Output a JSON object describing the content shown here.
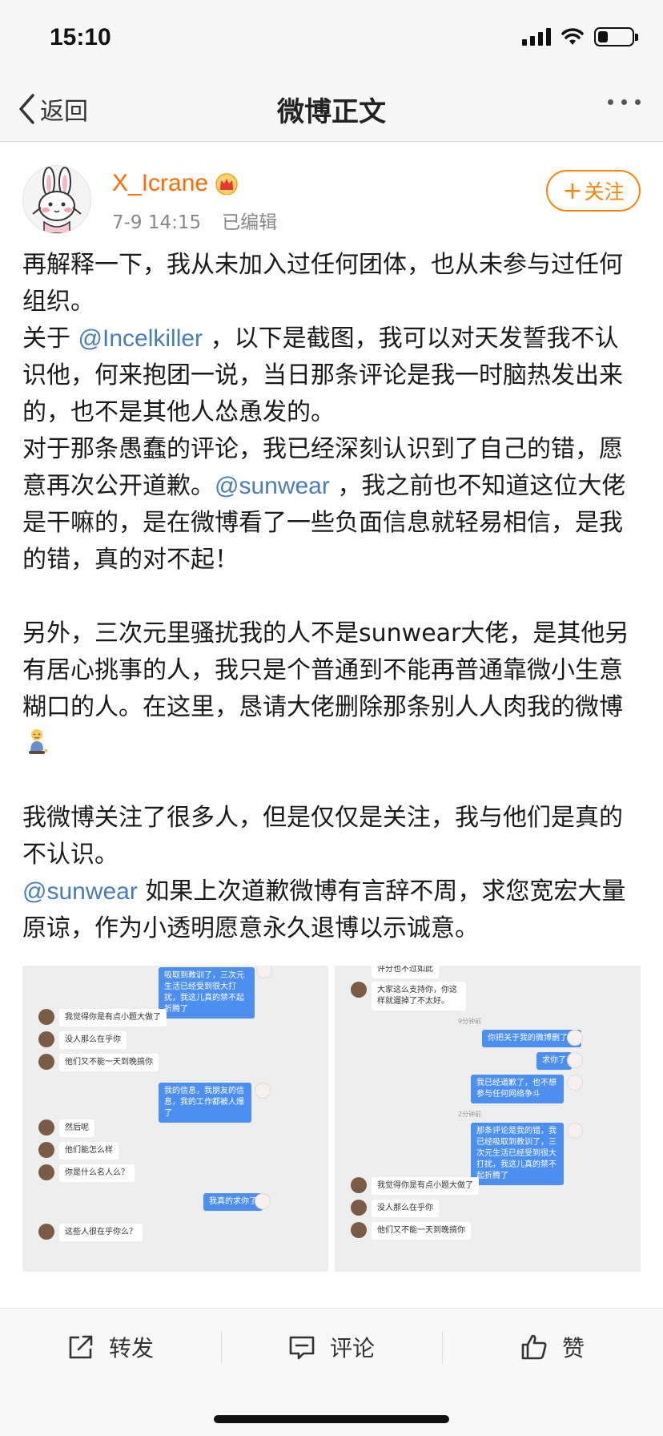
{
  "status_bar": {
    "time": "15:10",
    "battery_level": 0.3
  },
  "nav": {
    "back_label": "返回",
    "title": "微博正文"
  },
  "author": {
    "username": "X_Icrane",
    "date": "7-9 14:15",
    "edited": "已编辑",
    "follow_label": "关注",
    "name_color": "#ff6a00",
    "badge_icon": "crown-badge-icon"
  },
  "post": {
    "p1": "再解释一下，我从未加入过任何团体，也从未参与过任何组织。",
    "p2_pre": "关于 ",
    "mention1": "@Incelkiller",
    "p2_post": " ，以下是截图，我可以对天发誓我不认识他，何来抱团一说，当日那条评论是我一时脑热发出来的，也不是其他人怂恿发的。",
    "p3_pre": "对于那条愚蠢的评论，我已经深刻认识到了自己的错，愿意再次公开道歉。",
    "mention2": "@sunwear",
    "p3_post": " ，我之前也不知道这位大佬是干嘛的，是在微博看了一些负面信息就轻易相信，是我的错，真的对不起！",
    "p4": "另外，三次元里骚扰我的人不是sunwear大佬，是其他另有居心挑事的人，我只是个普通到不能再普通靠微小生意糊口的人。在这里，恳请大佬删除那条别人人肉我的微博",
    "p5": "我微博关注了很多人，但是仅仅是关注，我与他们是真的不认识。",
    "mention3": "@sunwear",
    "p6_post": " 如果上次道歉微博有言辞不周，求您宽宏大量原谅，作为小透明愿意永久退博以示诚意。",
    "mention_color": "#4a7db8"
  },
  "screenshot1": {
    "messages": [
      "吸取到教训了，三次元生活已经受到很大打扰，我这儿真的禁不起折腾了",
      "我觉得你是有点小题大做了",
      "没人那么在乎你",
      "他们又不能一天到晚搞你",
      "我的信息，我朋友的信息，我的工作都被人爆了",
      "然后呢",
      "他们能怎么样",
      "你是什么名人么？",
      "我真的求你了",
      "这些人很在乎你么？"
    ]
  },
  "screenshot2": {
    "messages": [
      "评分也不过如此",
      "大家这么支持你，你这样就遛掉了不太好。",
      "你把关于我的微博删了吧",
      "求你了",
      "我已经道歉了，也不想参与任何网络争斗",
      "那条评论是我的错，我已经吸取到教训了，三次元生活已经受到很大打扰，我这儿真的禁不起折腾了",
      "我觉得你是有点小题大做了",
      "没人那么在乎你",
      "他们又不能一天到晚搞你"
    ],
    "time1": "9分钟前",
    "time2": "2分钟前"
  },
  "actions": {
    "repost": "转发",
    "comment": "评论",
    "like": "赞"
  }
}
